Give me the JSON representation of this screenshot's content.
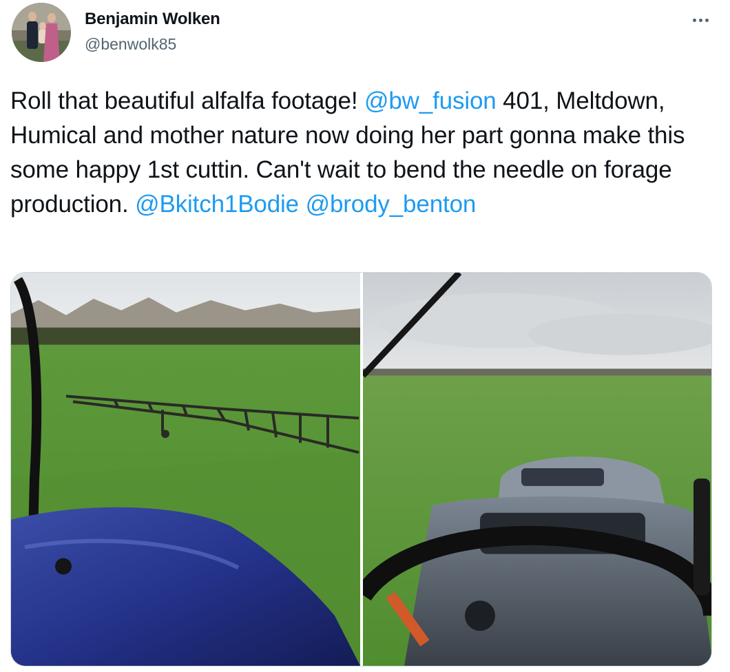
{
  "author": {
    "display_name": "Benjamin Wolken",
    "handle": "@benwolk85"
  },
  "tweet": {
    "segments": [
      {
        "text": "Roll that beautiful alfalfa footage! ",
        "type": "text"
      },
      {
        "text": "@bw_fusion",
        "type": "mention"
      },
      {
        "text": " 401, Meltdown, Humical and mother nature now doing her part gonna make this some happy 1st cuttin. Can't wait to bend the needle on forage production. ",
        "type": "text"
      },
      {
        "text": "@Bkitch1Bodie",
        "type": "mention"
      },
      {
        "text": " ",
        "type": "text"
      },
      {
        "text": "@brody_benton",
        "type": "mention"
      }
    ]
  },
  "media": {
    "photos": [
      {
        "icon": "photo-alfalfa-field-sprayer-boom"
      },
      {
        "icon": "photo-alfalfa-field-tractor-cab"
      }
    ]
  },
  "icons": {
    "more": "more-horizontal-icon"
  },
  "colors": {
    "mention": "#1d9bf0",
    "secondary_text": "#536471",
    "border": "#cfd9de"
  }
}
